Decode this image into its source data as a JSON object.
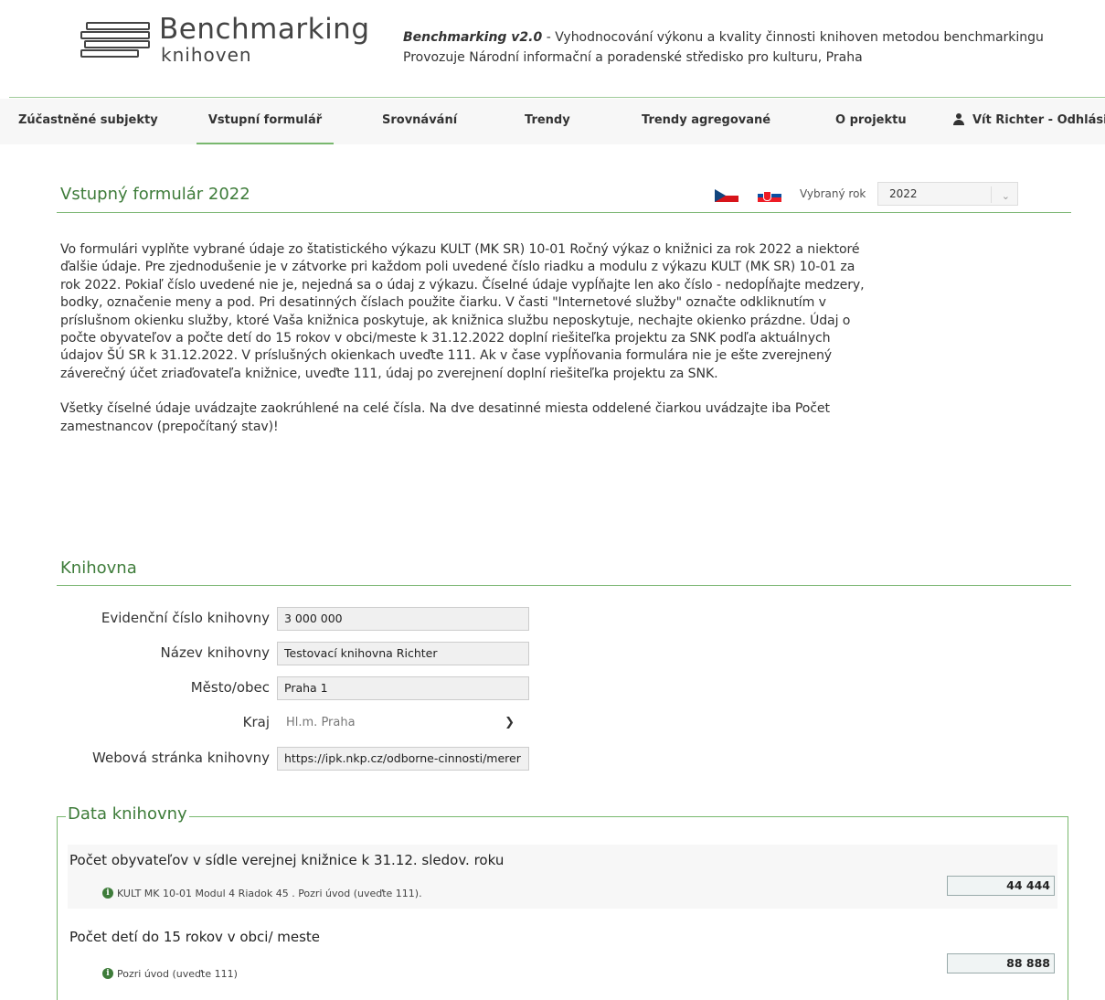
{
  "header": {
    "logo_title": "Benchmarking",
    "logo_sub": "knihoven",
    "tagline_bold": "Benchmarking v2.0",
    "tagline_rest": " - Vyhodnocování výkonu a kvality činnosti knihoven metodou benchmarkingu",
    "tagline_line2": "Provozuje Národní informační a poradenské středisko pro kulturu, Praha"
  },
  "nav": {
    "items": [
      {
        "label": "Zúčastněné subjekty"
      },
      {
        "label": "Vstupní formulář"
      },
      {
        "label": "Srovnávání"
      },
      {
        "label": "Trendy"
      },
      {
        "label": "Trendy agregované"
      },
      {
        "label": "O projektu"
      }
    ],
    "user_label": "Vít Richter - Odhlásit",
    "active": "Vstupní formulář"
  },
  "form": {
    "title": "Vstupný formulár 2022",
    "year_label": "Vybraný rok",
    "year_value": "2022",
    "intro_p1": "Vo formulári vyplňte vybrané údaje zo štatistického výkazu KULT (MK SR) 10-01 Ročný výkaz o knižnici za rok 2022 a niektoré ďalšie údaje. Pre zjednodušenie je v zátvorke pri každom poli uvedené číslo riadku a modulu z výkazu KULT (MK SR) 10-01 za rok 2022. Pokiaľ číslo uvedené nie je, nejedná sa o údaj z výkazu. Číselné údaje vypĺňajte len ako číslo - nedopĺňajte medzery, bodky, označenie meny a pod. Pri desatinných číslach použite čiarku. V časti \"Internetové služby\" označte odkliknutím v príslušnom okienku služby, ktoré Vaša knižnica poskytuje, ak knižnica službu neposkytuje, nechajte okienko prázdne. Údaj o počte obyvateľov a počte detí do 15 rokov v obci/meste k 31.12.2022 doplní riešiteľka projektu za SNK podľa aktuálnych údajov ŠÚ SR k 31.12.2022. V príslušných okienkach uveďte 111. Ak v čase vypĺňovania formulára nie je ešte zverejnený záverečný účet zriaďovateľa knižnice, uveďte 111, údaj po zverejnení doplní riešiteľka projektu za SNK.",
    "intro_p2": "Všetky číselné údaje uvádzajte zaokrúhlené na celé čísla. Na dve desatinné miesta oddelené čiarkou uvádzajte iba Počet zamestnancov (prepočítaný stav)!"
  },
  "library": {
    "section_title": "Knihovna",
    "fields": [
      {
        "label": "Evidenční číslo knihovny",
        "value": "3 000 000"
      },
      {
        "label": "Název knihovny",
        "value": "Testovací knihovna Richter"
      },
      {
        "label": "Město/obec",
        "value": "Praha 1"
      },
      {
        "label": "Kraj",
        "value": "Hl.m. Praha"
      },
      {
        "label": "Webová stránka knihovny",
        "value": "https://ipk.nkp.cz/odborne-cinnosti/merer"
      }
    ]
  },
  "data": {
    "legend": "Data knihovny",
    "rows": [
      {
        "title": "Počet obyvateľov v sídle verejnej knižnice k 31.12. sledov. roku",
        "hint": "KULT MK 10-01 Modul 4 Riadok 45 . Pozri úvod (uveďte 111).",
        "value": "44 444"
      },
      {
        "title": "Počet detí do 15 rokov v obci/ meste",
        "hint": "Pozri úvod (uveďte 111)",
        "value": "88 888"
      }
    ]
  },
  "colors": {
    "accent_green": "#3e7c3a",
    "line_green": "#7fb877"
  }
}
